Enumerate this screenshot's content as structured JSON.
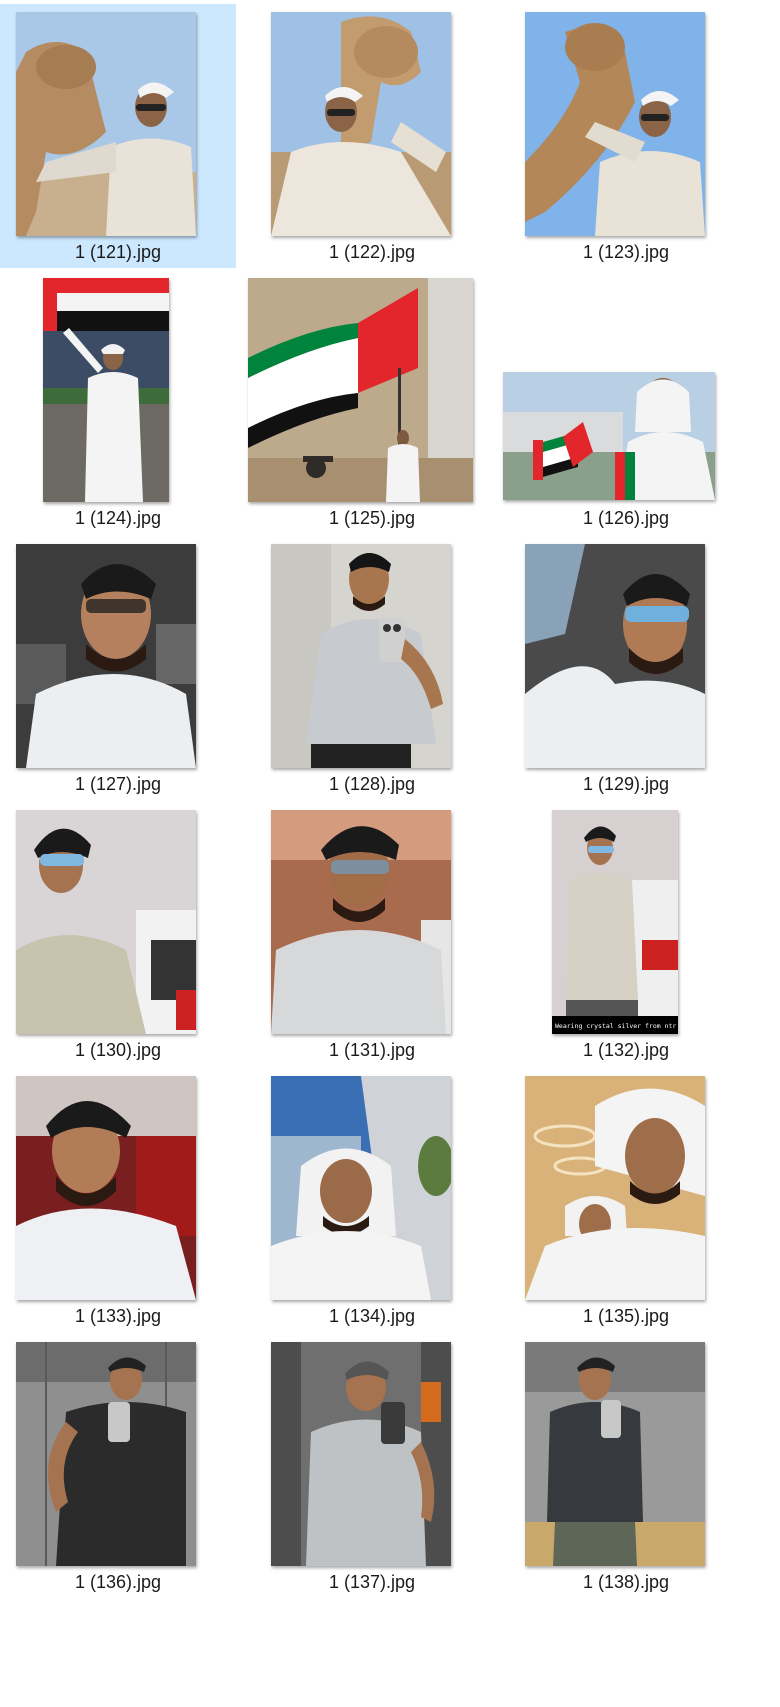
{
  "window": {
    "view": "Large icons"
  },
  "selection": {
    "selected_file": "1 (121).jpg"
  },
  "files": [
    {
      "name": "1 (121).jpg",
      "subject": "man in white kandura and cap with camel, blue sky",
      "selected": true
    },
    {
      "name": "1 (122).jpg",
      "subject": "man with camel behind him, desert",
      "selected": false
    },
    {
      "name": "1 (123).jpg",
      "subject": "man hugging camel, blue sky",
      "selected": false
    },
    {
      "name": "1 (124).jpg",
      "subject": "man in kandura holding UAE flag at night",
      "selected": false
    },
    {
      "name": "1 (125).jpg",
      "subject": "man waving large UAE flag at fort",
      "selected": false
    },
    {
      "name": "1 (126).jpg",
      "subject": "man in ghutra holding small UAE flags",
      "selected": false
    },
    {
      "name": "1 (127).jpg",
      "subject": "selfie in car, white shirt, sunglasses",
      "selected": false
    },
    {
      "name": "1 (128).jpg",
      "subject": "mirror selfie with phone, grey shirt",
      "selected": false
    },
    {
      "name": "1 (129).jpg",
      "subject": "car selfie, mirrored sunglasses",
      "selected": false
    },
    {
      "name": "1 (130).jpg",
      "subject": "man in cap and beige t-shirt by car",
      "selected": false
    },
    {
      "name": "1 (131).jpg",
      "subject": "man in cap in desert at sunset",
      "selected": false
    },
    {
      "name": "1 (132).jpg",
      "subject": "man in cap standing by white car",
      "caption": "Wearing crystal silver from ntr ae",
      "selected": false
    },
    {
      "name": "1 (133).jpg",
      "subject": "man in white kandura in red car interior",
      "selected": false
    },
    {
      "name": "1 (134).jpg",
      "subject": "man in ghutra, building and blue sky",
      "selected": false
    },
    {
      "name": "1 (135).jpg",
      "subject": "two men in ghutra, mall ceiling",
      "selected": false
    },
    {
      "name": "1 (136).jpg",
      "subject": "gym mirror selfie, black t-shirt, NY cap",
      "selected": false
    },
    {
      "name": "1 (137).jpg",
      "subject": "gym mirror selfie, grey t-shirt, cap",
      "selected": false
    },
    {
      "name": "1 (138).jpg",
      "subject": "gym mirror selfie, dark long sleeve",
      "selected": false
    }
  ],
  "colors": {
    "selection_bg": "#cce8ff",
    "label_text": "#1a1a1a",
    "uae_red": "#e2262b",
    "uae_green": "#00843d",
    "uae_black": "#111111"
  }
}
